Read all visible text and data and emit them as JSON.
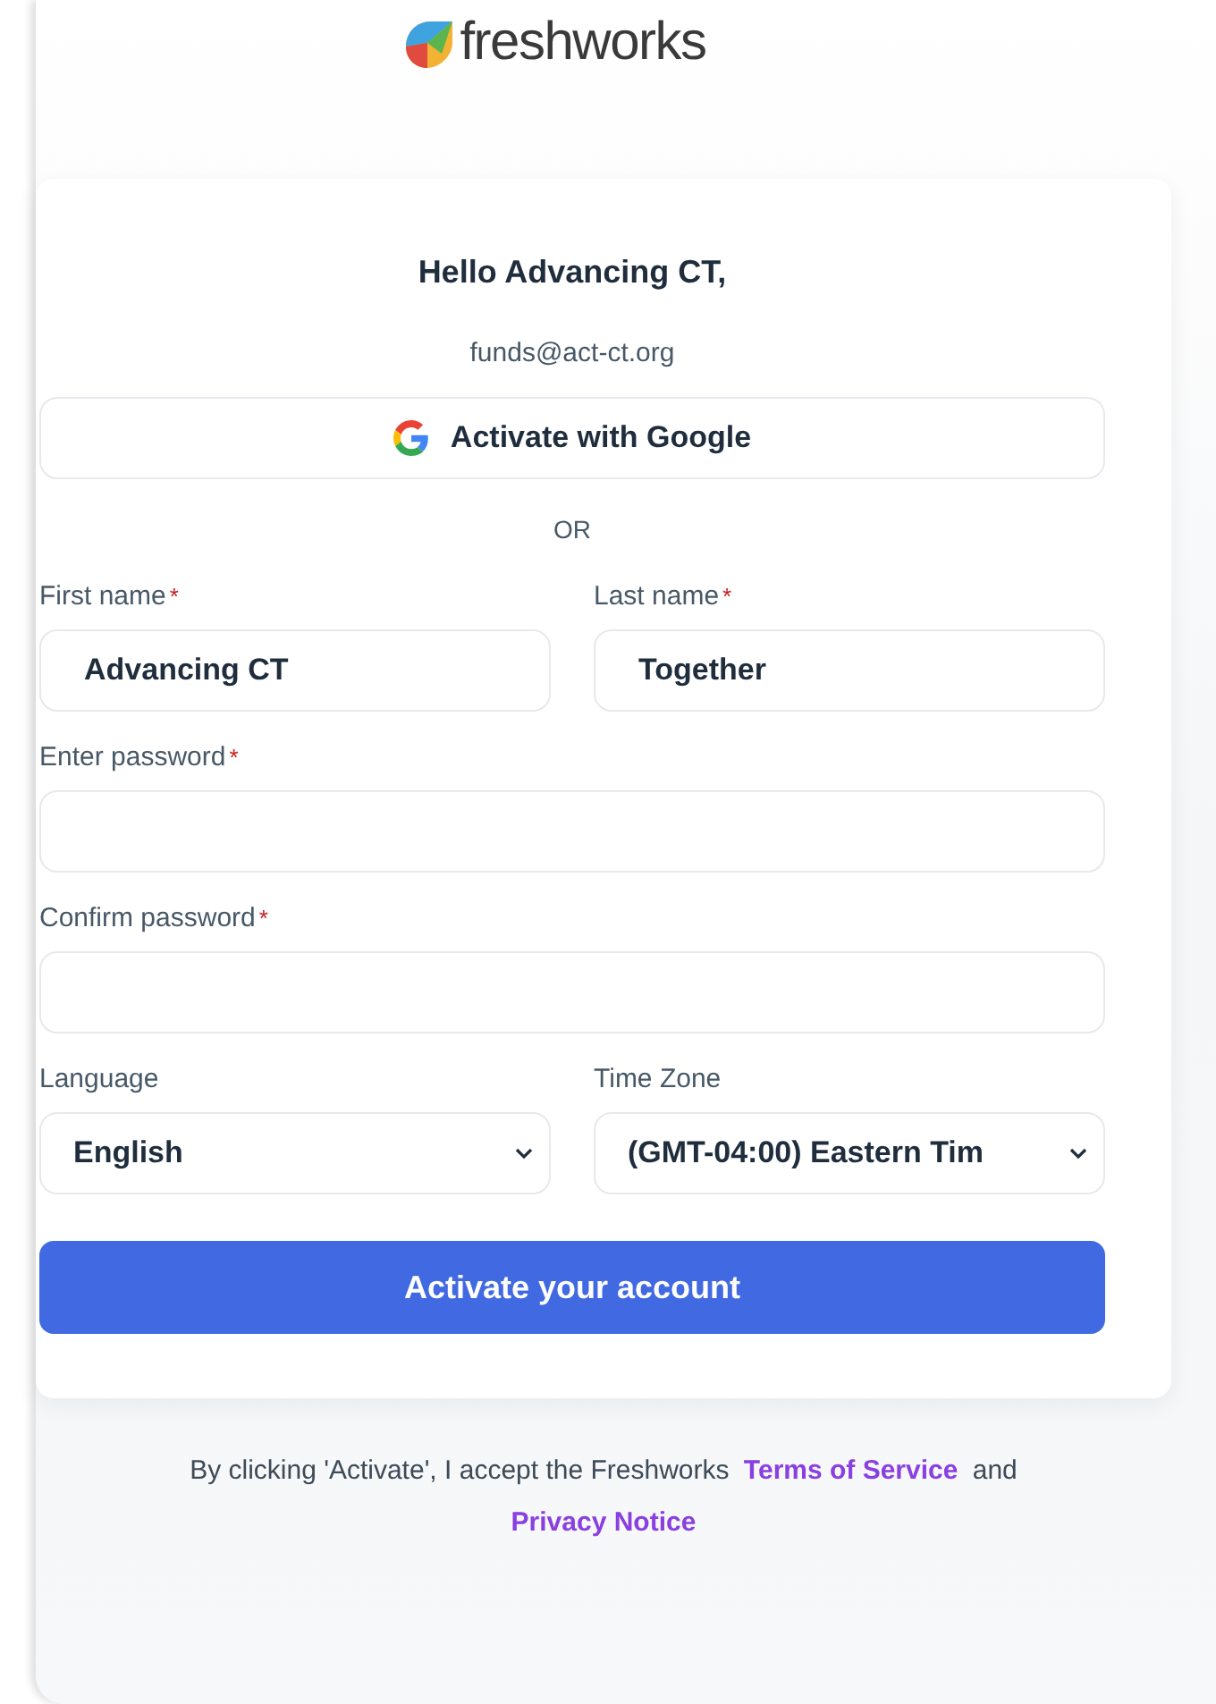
{
  "brand": {
    "name": "freshworks"
  },
  "card": {
    "greeting": "Hello Advancing CT,",
    "email": "funds@act-ct.org",
    "google_button": "Activate with Google",
    "divider": "OR",
    "fields": [
      {
        "kind": "text",
        "label": "First name",
        "required_mark": "*",
        "value": "Advancing CT"
      },
      {
        "kind": "text",
        "label": "Last name",
        "required_mark": "*",
        "value": "Together"
      },
      {
        "kind": "password",
        "label": "Enter password",
        "required_mark": "*"
      },
      {
        "kind": "password",
        "label": "Confirm password",
        "required_mark": "*"
      },
      {
        "kind": "select",
        "label": "Language",
        "value": "English"
      },
      {
        "kind": "select",
        "label": "Time Zone",
        "value": "(GMT-04:00) Eastern Tim"
      }
    ],
    "submit_button": "Activate your account"
  },
  "footer": {
    "text": "By clicking 'Activate', I accept the Freshworks",
    "links": [
      "Terms of Service",
      "Privacy Notice"
    ],
    "joiner": "and"
  }
}
